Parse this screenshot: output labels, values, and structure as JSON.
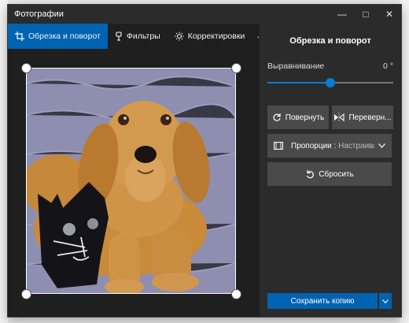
{
  "window": {
    "title": "Фотографии"
  },
  "toolbar": {
    "tabs": [
      {
        "label": "Обрезка и поворот",
        "icon": "crop-icon"
      },
      {
        "label": "Фильтры",
        "icon": "filter-icon"
      },
      {
        "label": "Корректировки",
        "icon": "brightness-icon"
      }
    ],
    "more": "···"
  },
  "panel": {
    "title": "Обрезка и поворот",
    "straighten_label": "Выравнивание",
    "straighten_value": "0 °",
    "straighten_slider_fraction": 0.5,
    "rotate_label": "Повернуть",
    "flip_label": "Переверн...",
    "aspect_label": "Пропорции :",
    "aspect_value": "Настраиваем...",
    "reset_label": "Сбросить",
    "save_label": "Сохранить копию"
  },
  "colors": {
    "accent": "#0063b1",
    "panel_bg": "#2b2b2b",
    "canvas_bg": "#1f1f1f"
  }
}
